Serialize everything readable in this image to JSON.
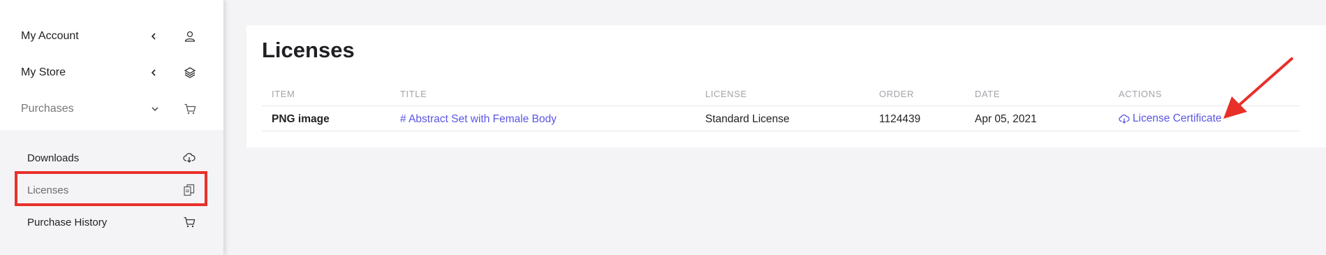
{
  "sidebar": {
    "items": [
      {
        "label": "My Account",
        "icon": "user-icon",
        "chevron": "left"
      },
      {
        "label": "My Store",
        "icon": "layers-icon",
        "chevron": "left"
      },
      {
        "label": "Purchases",
        "icon": "cart-icon",
        "chevron": "down"
      }
    ],
    "submenu": [
      {
        "label": "Downloads",
        "icon": "cloud-download-icon"
      },
      {
        "label": "Licenses",
        "icon": "copy-icon"
      },
      {
        "label": "Purchase History",
        "icon": "cart-icon"
      }
    ]
  },
  "main": {
    "title": "Licenses",
    "table": {
      "headers": [
        "ITEM",
        "TITLE",
        "LICENSE",
        "ORDER",
        "DATE",
        "ACTIONS"
      ],
      "rows": [
        {
          "item": "PNG image",
          "title": "# Abstract Set with Female Body",
          "license": "Standard License",
          "order": "1124439",
          "date": "Apr 05, 2021",
          "action": "License Certificate"
        }
      ]
    }
  },
  "colors": {
    "link": "#5a55e6",
    "annotation": "#e8302a",
    "background": "#f4f4f7"
  }
}
